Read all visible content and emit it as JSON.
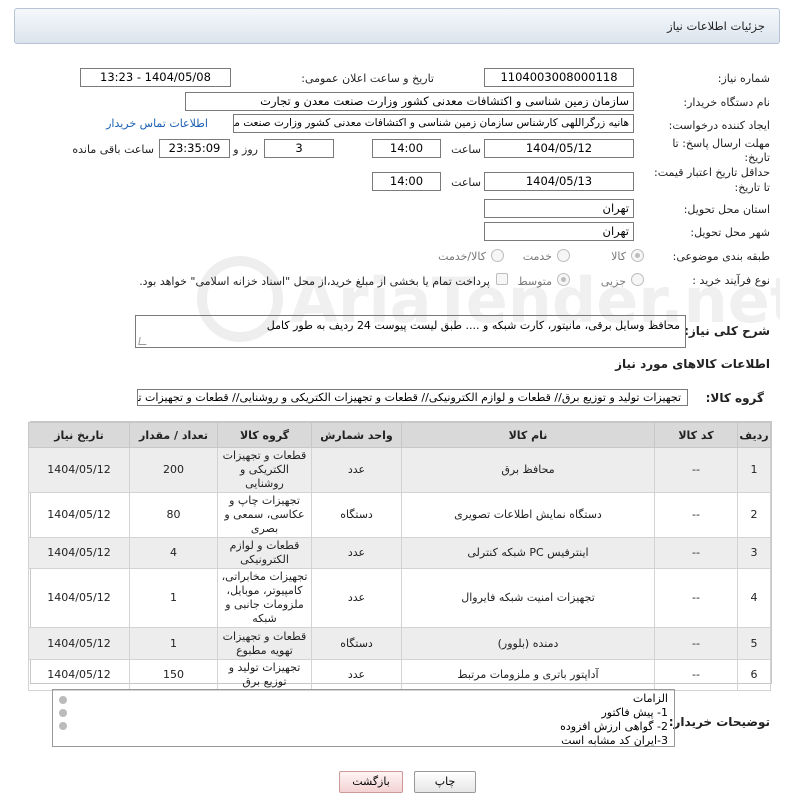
{
  "header": {
    "title": "جزئیات اطلاعات نیاز"
  },
  "fields": {
    "need_number_label": "شماره نیاز:",
    "need_number": "1104003008000118",
    "announce_label": "تاریخ و ساعت اعلان عمومی:",
    "announce_value": "1404/05/08 - 13:23",
    "buyer_label": "نام دستگاه خریدار:",
    "buyer_value": "سازمان زمین شناسی و اکتشافات معدنی کشور وزارت صنعت معدن و تجارت",
    "creator_label": "ایجاد کننده درخواست:",
    "creator_value": "هانیه زرگراللهی کارشناس سازمان زمین شناسی و اکتشافات معدنی کشور وزارت صنعت معدن و تجارت",
    "contact_link": "اطلاعات تماس خریدار",
    "reply_deadline_label_1": "مهلت ارسال پاسخ: تا",
    "reply_deadline_label_2": "تاریخ:",
    "reply_date": "1404/05/12",
    "time_label": "ساعت",
    "reply_time": "14:00",
    "days_value": "3",
    "days_label": "روز و",
    "remaining_value": "23:35:09",
    "remaining_label": "ساعت باقی مانده",
    "validity_label_1": "حداقل تاریخ اعتبار قیمت:",
    "validity_label_2": "تا تاریخ:",
    "validity_date": "1404/05/13",
    "validity_time": "14:00",
    "province_label": "استان محل تحویل:",
    "province_value": "تهران",
    "city_label": "شهر محل تحویل:",
    "city_value": "تهران",
    "category_label": "طبقه بندی موضوعی:",
    "category_options": [
      "کالا",
      "خدمت",
      "کالا/خدمت"
    ],
    "process_label": "نوع فرآیند خرید :",
    "process_options": [
      "جزیی",
      "متوسط"
    ],
    "process_note": "پرداخت تمام یا بخشی از مبلغ خرید،از محل \"اسناد خزانه اسلامی\" خواهد بود."
  },
  "description": {
    "label": "شرح کلی نیاز:",
    "value": "محافظ وسایل برقی، مانیتور، کارت شبکه و .... طبق لیست پیوست 24 ردیف به طور کامل"
  },
  "goods": {
    "section_title": "اطلاعات کالاهای مورد نیاز",
    "group_label": "گروه کالا:",
    "group_value": "تجهیزات تولید و توزیع برق// قطعات و لوازم الکترونیکی// قطعات و تجهیزات الکتریکی و روشنایی// قطعات و تجهیزات تهویه مطبوع",
    "columns": [
      "ردیف",
      "کد کالا",
      "نام کالا",
      "واحد شمارش",
      "گروه کالا",
      "تعداد / مقدار",
      "تاریخ نیاز"
    ],
    "rows": [
      {
        "idx": "1",
        "code": "--",
        "name": "محافظ برق",
        "unit": "عدد",
        "group": "قطعات و تجهیزات الکتریکی و روشنایی",
        "qty": "200",
        "date": "1404/05/12"
      },
      {
        "idx": "2",
        "code": "--",
        "name": "دستگاه نمایش اطلاعات تصویری",
        "unit": "دستگاه",
        "group": "تجهیزات چاپ و عکاسی، سمعی و بصری",
        "qty": "80",
        "date": "1404/05/12"
      },
      {
        "idx": "3",
        "code": "--",
        "name": "اینترفیس PC شبکه کنترلی",
        "unit": "عدد",
        "group": "قطعات و لوازم الکترونیکی",
        "qty": "4",
        "date": "1404/05/12"
      },
      {
        "idx": "4",
        "code": "--",
        "name": "تجهیزات امنیت شبکه فایروال",
        "unit": "عدد",
        "group": "تجهیزات مخابراتی، کامپیوتر، موبایل، ملزومات جانبی و شبکه",
        "qty": "1",
        "date": "1404/05/12"
      },
      {
        "idx": "5",
        "code": "--",
        "name": "دمنده (بلوور)",
        "unit": "دستگاه",
        "group": "قطعات و تجهیزات تهویه مطبوع",
        "qty": "1",
        "date": "1404/05/12"
      },
      {
        "idx": "6",
        "code": "--",
        "name": "آداپتور باتری و ملزومات مرتبط",
        "unit": "عدد",
        "group": "تجهیزات تولید و توزیع برق",
        "qty": "150",
        "date": "1404/05/12"
      }
    ]
  },
  "notes": {
    "label": "توضیحات خریدار:",
    "lines": [
      "الزامات",
      "1-  پیش فاکتور",
      "2- گواهی ارزش افزوده",
      "3-ایران کد مشابه است"
    ]
  },
  "buttons": {
    "print": "چاپ",
    "back": "بازگشت"
  },
  "colors": {
    "link": "#1a5fb4",
    "header_bg": "#dbe4ee",
    "table_header": "#d9d9d9",
    "back_button": "#f3d2d2"
  }
}
